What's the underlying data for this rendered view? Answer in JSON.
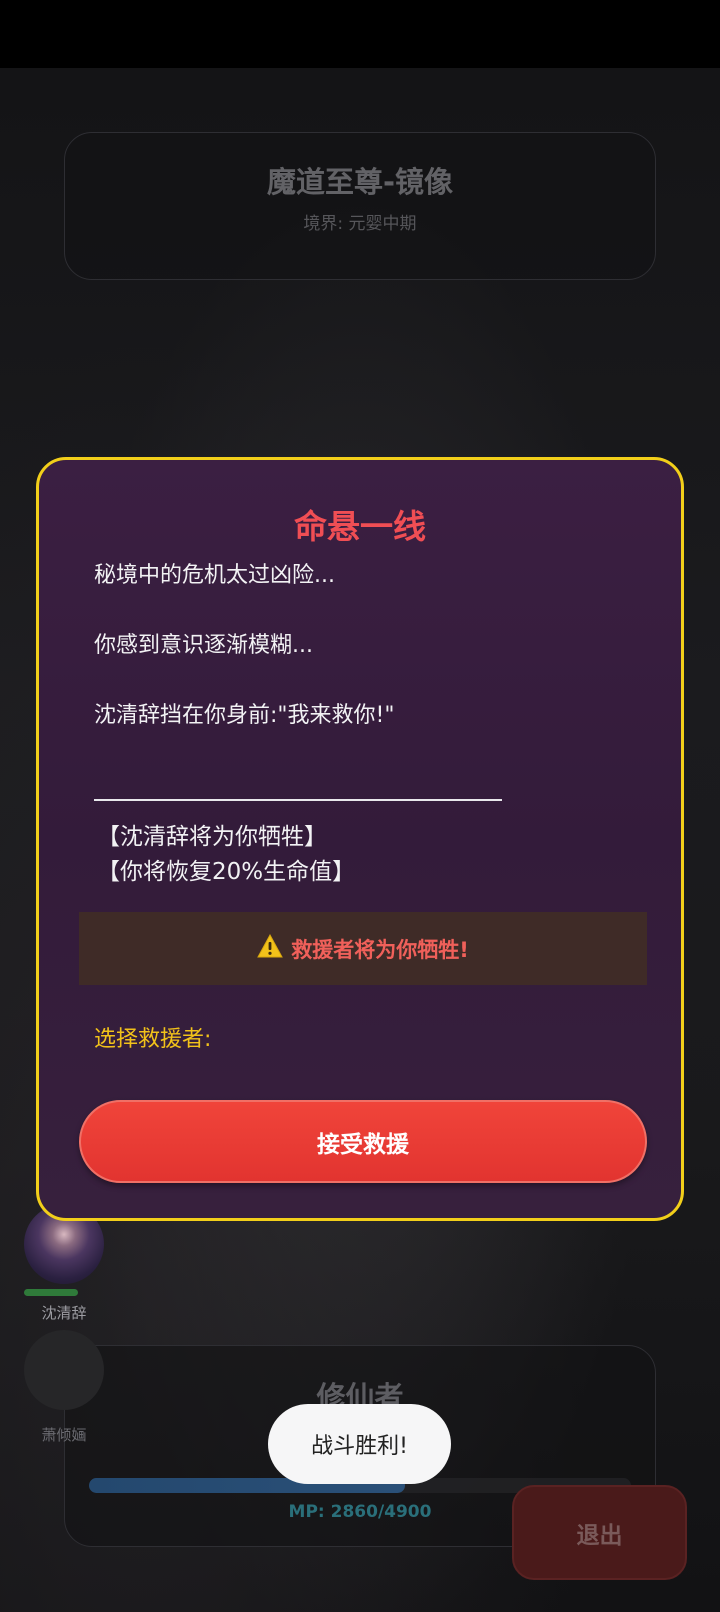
{
  "enemy": {
    "name": "魔道至尊-镜像",
    "realm": "境界: 元婴中期"
  },
  "player": {
    "name": "修仙者",
    "mp_text": "MP: 2860/4900",
    "mp_fraction": 0.5837
  },
  "allies": [
    {
      "name": "沈清辞",
      "hp_fraction": 1.0
    },
    {
      "name": "萧倾婳"
    }
  ],
  "exit_label": "退出",
  "toast": "战斗胜利!",
  "modal": {
    "title": "命悬一线",
    "story": [
      "秘境中的危机太过凶险...",
      "你感到意识逐渐模糊...",
      "沈清辞挡在你身前:\"我来救你!\""
    ],
    "effects": [
      "【沈清辞将为你牺牲】",
      "【你将恢复20%生命值】"
    ],
    "warning_icon": "warning-icon",
    "warning": "救援者将为你牺牲!",
    "select_label": "选择救援者:",
    "accept_label": "接受救援"
  }
}
